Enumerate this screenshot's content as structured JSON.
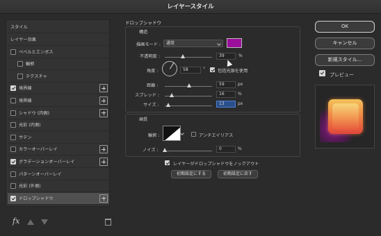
{
  "window_title": "レイヤースタイル",
  "left_panel": {
    "header": "スタイル",
    "items": [
      {
        "label": "レイヤー効果",
        "checkbox": null,
        "plus": false,
        "indent": 0
      },
      {
        "label": "ベベルとエンボス",
        "checkbox": false,
        "plus": false,
        "indent": 0
      },
      {
        "label": "輪郭",
        "checkbox": false,
        "plus": false,
        "indent": 1
      },
      {
        "label": "テクスチャ",
        "checkbox": false,
        "plus": false,
        "indent": 1
      },
      {
        "label": "境界線",
        "checkbox": true,
        "plus": true,
        "indent": 0
      },
      {
        "label": "境界線",
        "checkbox": false,
        "plus": true,
        "indent": 0
      },
      {
        "label": "シャドウ (内側)",
        "checkbox": false,
        "plus": true,
        "indent": 0
      },
      {
        "label": "光彩 (内側)",
        "checkbox": false,
        "plus": false,
        "indent": 0
      },
      {
        "label": "サテン",
        "checkbox": false,
        "plus": false,
        "indent": 0
      },
      {
        "label": "カラーオーバーレイ",
        "checkbox": false,
        "plus": true,
        "indent": 0
      },
      {
        "label": "グラデーションオーバーレイ",
        "checkbox": true,
        "plus": true,
        "indent": 0
      },
      {
        "label": "パターンオーバーレイ",
        "checkbox": false,
        "plus": false,
        "indent": 0
      },
      {
        "label": "光彩 (外側)",
        "checkbox": false,
        "plus": false,
        "indent": 0
      },
      {
        "label": "ドロップシャドウ",
        "checkbox": true,
        "plus": true,
        "indent": 0,
        "selected": true
      }
    ],
    "fx_label": "fx"
  },
  "drop_shadow": {
    "section_title": "ドロップシャドウ",
    "structure_title": "構造",
    "blend_mode_label": "描画モード :",
    "blend_mode_value": "通常",
    "shadow_color": "#9b0e9b",
    "opacity_label": "不透明度 :",
    "opacity_value": "39",
    "opacity_unit": "%",
    "angle_label": "角度 :",
    "angle_value": "58",
    "angle_unit": "°",
    "global_light_label": "包括光源を使用",
    "global_light_checked": true,
    "distance_label": "距離 :",
    "distance_value": "59",
    "distance_unit": "px",
    "spread_label": "スプレッド :",
    "spread_value": "16",
    "spread_unit": "%",
    "size_label": "サイズ :",
    "size_value": "13",
    "size_unit": "px",
    "quality_title": "画質",
    "contour_label": "輪郭 :",
    "antialias_label": "アンチエイリアス",
    "antialias_checked": false,
    "noise_label": "ノイズ :",
    "noise_value": "0",
    "noise_unit": "%",
    "knockout_label": "レイヤーがドロップシャドウをノックアウト",
    "knockout_checked": true,
    "make_default_label": "初期設定にする",
    "reset_default_label": "初期設定に戻す"
  },
  "right_panel": {
    "ok_label": "OK",
    "cancel_label": "キャンセル",
    "new_style_label": "新規スタイル...",
    "preview_label": "プレビュー",
    "preview_checked": true
  }
}
